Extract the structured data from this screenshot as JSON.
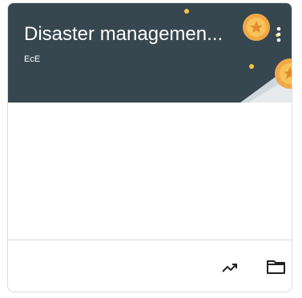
{
  "course_card": {
    "title": "Disaster managemen...",
    "section": "EcE",
    "banner_color": "#37474f",
    "more_icon": "more-vert-icon",
    "footer": {
      "actions": [
        {
          "icon": "trending-up-icon"
        },
        {
          "icon": "folder-icon"
        }
      ]
    }
  }
}
